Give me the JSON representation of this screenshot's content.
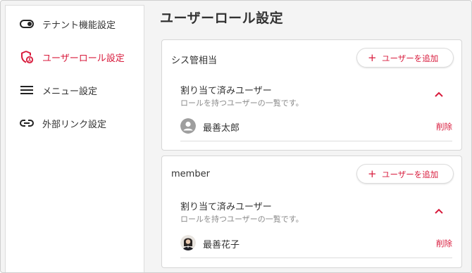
{
  "sidebar": {
    "items": [
      {
        "label": "テナント機能設定",
        "icon": "toggle-icon",
        "active": false
      },
      {
        "label": "ユーザーロール設定",
        "icon": "shield-user-icon",
        "active": true
      },
      {
        "label": "メニュー設定",
        "icon": "menu-icon",
        "active": false
      },
      {
        "label": "外部リンク設定",
        "icon": "link-icon",
        "active": false
      }
    ]
  },
  "main": {
    "title": "ユーザーロール設定",
    "roles": [
      {
        "name": "シス管相当",
        "add_button": "ユーザーを追加",
        "section_title": "割り当て済みユーザー",
        "section_subtitle": "ロールを持つユーザーの一覧です。",
        "users": [
          {
            "name": "最善太郎",
            "avatar": "default-avatar-icon",
            "delete_label": "削除"
          }
        ]
      },
      {
        "name": "member",
        "add_button": "ユーザーを追加",
        "section_title": "割り当て済みユーザー",
        "section_subtitle": "ロールを持つユーザーの一覧です。",
        "users": [
          {
            "name": "最善花子",
            "avatar": "photo-avatar",
            "delete_label": "削除"
          }
        ]
      }
    ]
  },
  "colors": {
    "accent": "#d81b3c",
    "text": "#333333",
    "muted": "#8a8a8a",
    "background": "#f4f4f4"
  }
}
